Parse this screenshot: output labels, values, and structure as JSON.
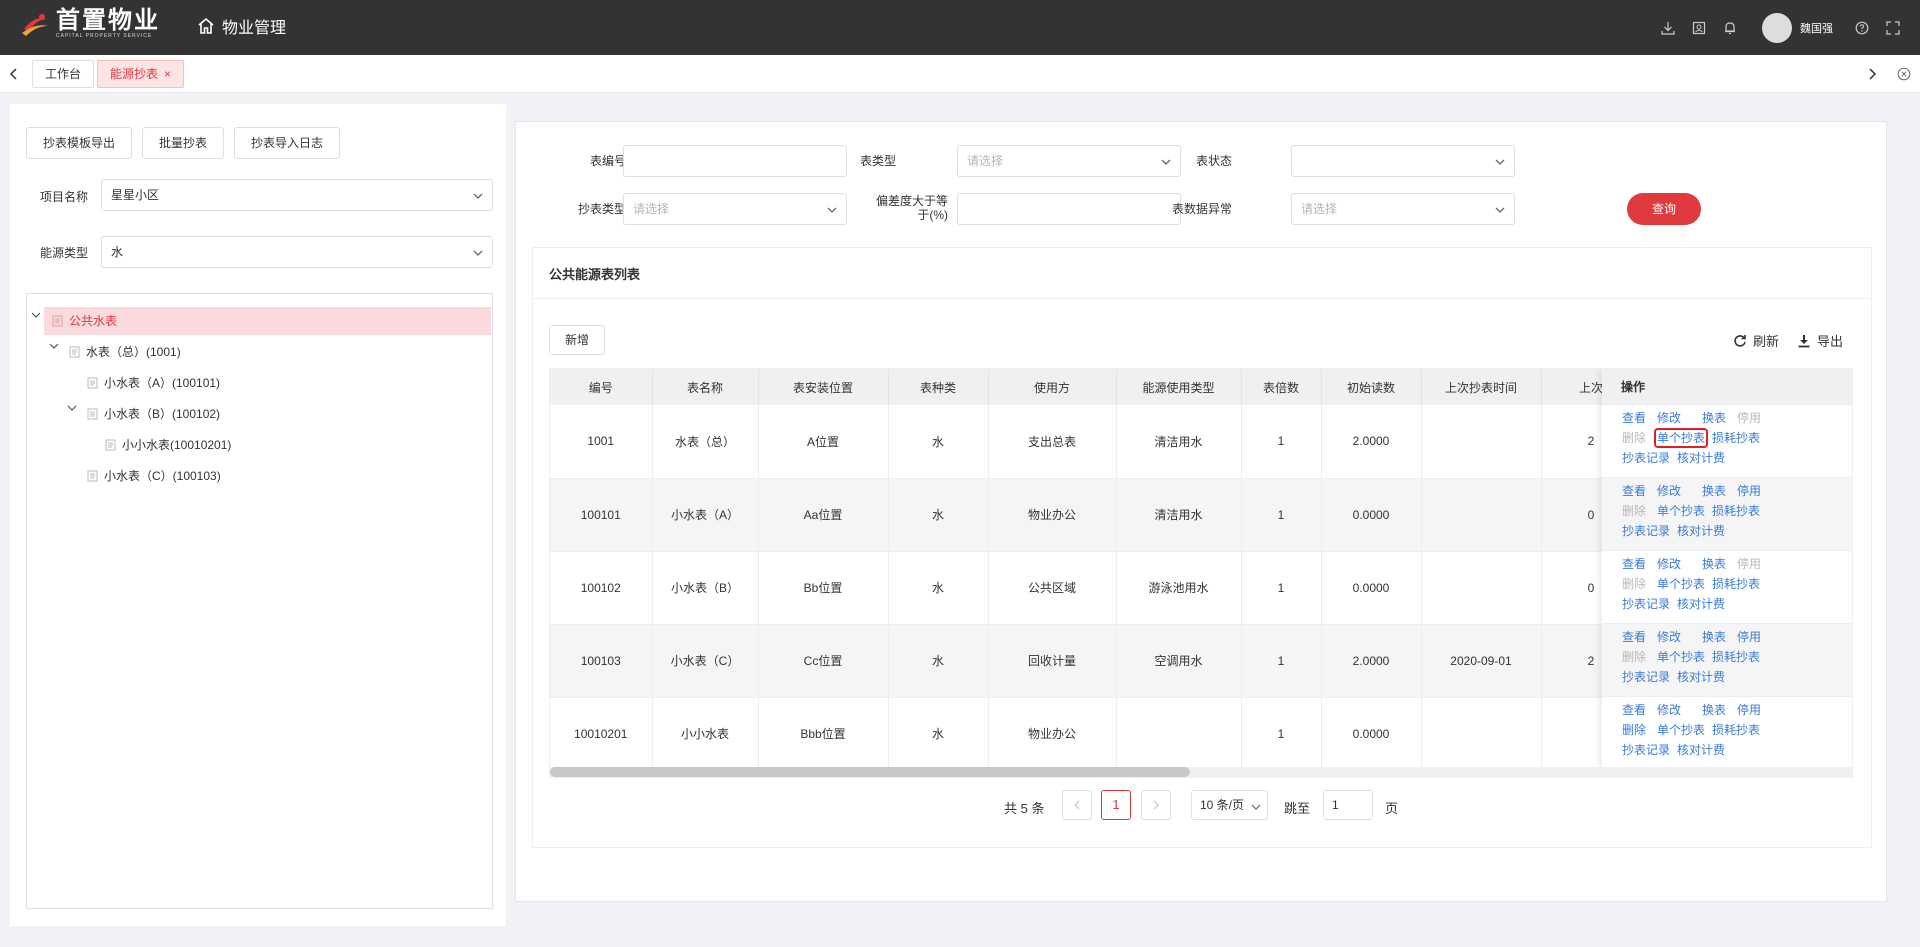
{
  "brand": {
    "name": "首置物业",
    "sub": "CAPITAL PROPERTY SERVICE",
    "red": "#e0393e"
  },
  "header": {
    "system": "物业管理",
    "user": "魏国强"
  },
  "tabs": [
    {
      "label": "工作台",
      "active": false
    },
    {
      "label": "能源抄表",
      "active": true,
      "close": "×"
    }
  ],
  "left": {
    "buttons": [
      "抄表模板导出",
      "批量抄表",
      "抄表导入日志"
    ],
    "project_label": "项目名称",
    "project_value": "星星小区",
    "energy_label": "能源类型",
    "energy_value": "水",
    "tree": [
      {
        "label": "公共水表",
        "selected": true
      },
      {
        "label": "水表（总）(1001)"
      },
      {
        "label": "小水表（A）(100101)"
      },
      {
        "label": "小水表（B）(100102)"
      },
      {
        "label": "小小水表(10010201)"
      },
      {
        "label": "小水表（C）(100103)"
      }
    ]
  },
  "filters": {
    "meter_no": {
      "label": "表编号"
    },
    "meter_type": {
      "label": "表类型",
      "placeholder": "请选择"
    },
    "meter_status": {
      "label": "表状态"
    },
    "read_type": {
      "label": "抄表类型",
      "placeholder": "请选择"
    },
    "deviation": {
      "label": "偏差度大于等于(%)"
    },
    "data_abnormal": {
      "label": "表数据异常",
      "placeholder": "请选择"
    },
    "query": "查询"
  },
  "list": {
    "title": "公共能源表列表",
    "add": "新增",
    "refresh": "刷新",
    "export": "导出",
    "columns": [
      "编号",
      "表名称",
      "表安装位置",
      "表种类",
      "使用方",
      "能源使用类型",
      "表倍数",
      "初始读数",
      "上次抄表时间",
      "上次"
    ],
    "op_header": "操作",
    "rows": [
      {
        "c": [
          "1001",
          "水表（总）",
          "A位置",
          "水",
          "支出总表",
          "清洁用水",
          "1",
          "2.0000",
          "",
          "2"
        ]
      },
      {
        "c": [
          "100101",
          "小水表（A）",
          "Aa位置",
          "水",
          "物业办公",
          "清洁用水",
          "1",
          "0.0000",
          "",
          "0"
        ]
      },
      {
        "c": [
          "100102",
          "小水表（B）",
          "Bb位置",
          "水",
          "公共区域",
          "游泳池用水",
          "1",
          "0.0000",
          "",
          "0"
        ]
      },
      {
        "c": [
          "100103",
          "小水表（C）",
          "Cc位置",
          "水",
          "回收计量",
          "空调用水",
          "1",
          "2.0000",
          "2020-09-01",
          "2"
        ]
      },
      {
        "c": [
          "10010201",
          "小小水表",
          "Bbb位置",
          "水",
          "物业办公",
          "",
          "1",
          "0.0000",
          "",
          ""
        ]
      }
    ],
    "ops": {
      "view": "查看",
      "edit": "修改",
      "replace": "换表",
      "disable": "停用",
      "delete": "删除",
      "single": "单个抄表",
      "loss": "损耗抄表",
      "records": "抄表记录",
      "check": "核对计费"
    },
    "op_rows": [
      {
        "disable_dis": true,
        "delete_dis": true,
        "highlight": true
      },
      {
        "disable_dis": false,
        "delete_dis": true,
        "highlight": false
      },
      {
        "disable_dis": true,
        "delete_dis": true,
        "highlight": false
      },
      {
        "disable_dis": false,
        "delete_dis": true,
        "highlight": false
      },
      {
        "disable_dis": false,
        "delete_dis": false,
        "highlight": false
      }
    ]
  },
  "pagination": {
    "total": "共 5 条",
    "current": "1",
    "size": "10 条/页",
    "goto": "跳至",
    "goto_value": "1",
    "page": "页"
  }
}
